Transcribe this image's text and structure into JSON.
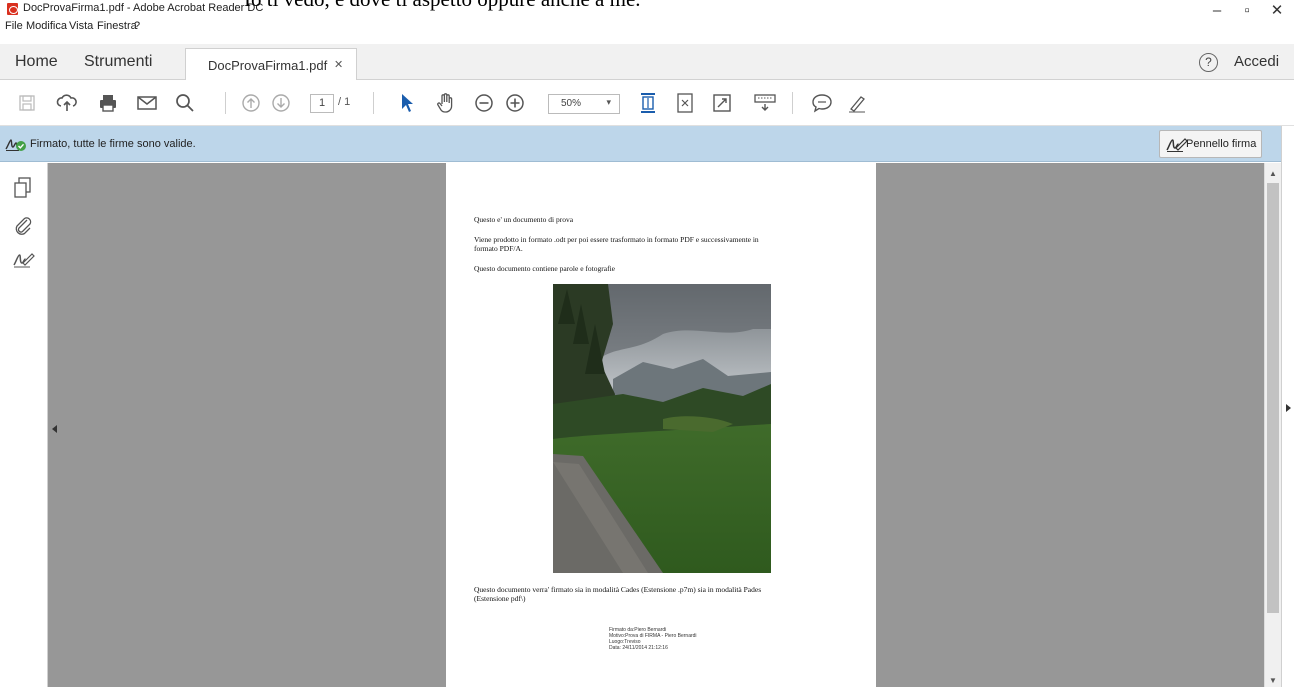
{
  "overlay_text": "Io ti vedo, e dove ti aspetto oppure anche a me.",
  "window": {
    "title": "DocProvaFirma1.pdf - Adobe Acrobat Reader DC",
    "minimize": "–",
    "maximize": "▫",
    "close": "✕"
  },
  "menu": {
    "file": "File",
    "modifica": "Modifica",
    "vista": "Vista",
    "finestra": "Finestra",
    "help": "?"
  },
  "tabs": {
    "home": "Home",
    "tools": "Strumenti",
    "document": "DocProvaFirma1.pdf",
    "close": "✕"
  },
  "account": {
    "help": "?",
    "signin": "Accedi"
  },
  "toolbar": {
    "page_current": "1",
    "page_total": "/ 1",
    "zoom": "50%",
    "zoom_caret": "▾"
  },
  "signature_bar": {
    "status": "Firmato, tutte le firme sono valide.",
    "button": "Pennello firma"
  },
  "document": {
    "line1": "Questo e' un documento di prova",
    "line2": "Viene prodotto in formato .odt per poi essere trasformato in formato PDF e successivamente in",
    "line2b": "formato PDF/A.",
    "line3": "Questo documento contiene parole e fotografie",
    "line4": "Questo documento verra' firmato sia in modalità Cades (Estensione .p7m) sia in modalità Pades",
    "line4b": "(Estensione pdf\\)",
    "sig1": "Firmato da:Piero Bernardi",
    "sig2": "Motivo:Prova di FIRMA - Piero Bernardi",
    "sig3": "Luogo:Treviso",
    "sig4": "Data: 24/11/2014 21:12:16"
  },
  "colors": {
    "sigbar": "#bdd6ea",
    "docbg": "#979797",
    "accent": "#1a5dad"
  }
}
